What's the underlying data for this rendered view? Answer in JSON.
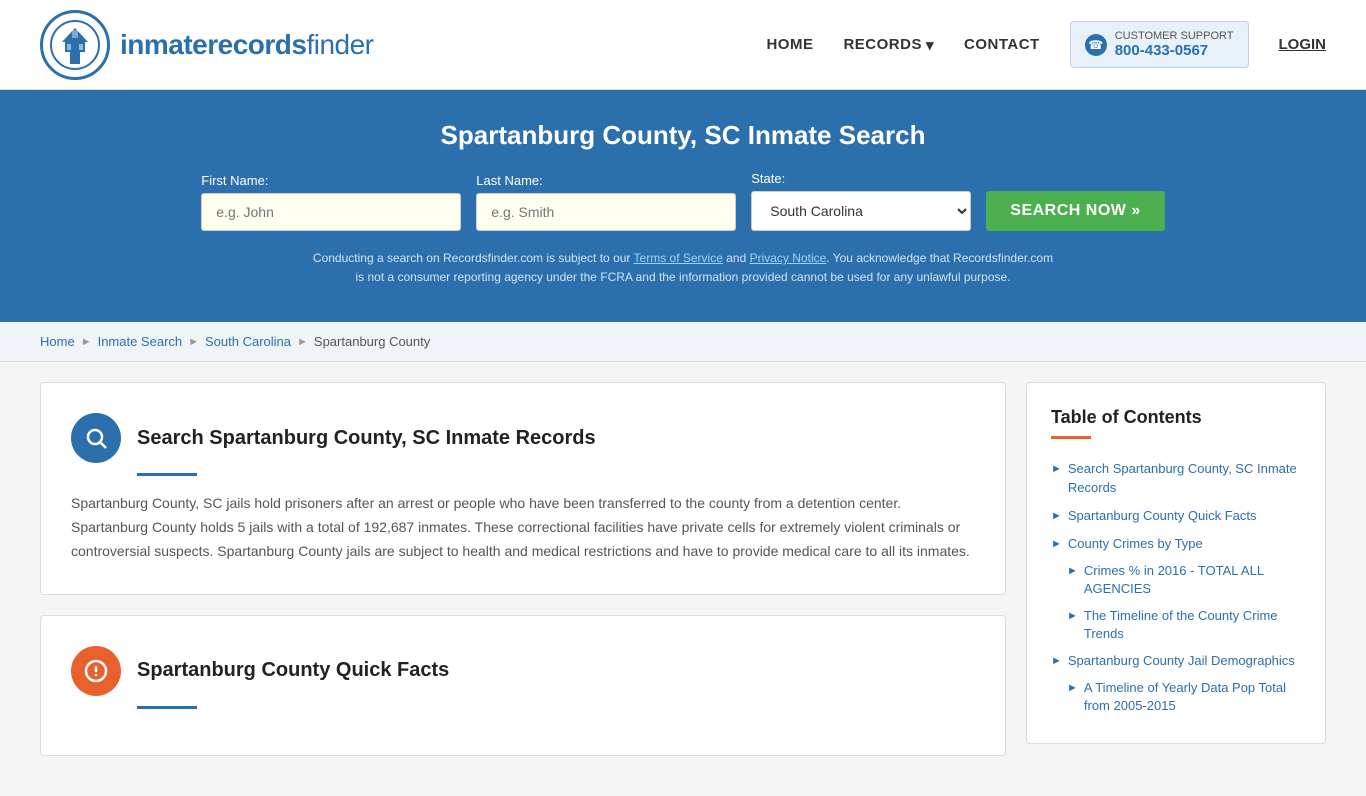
{
  "site": {
    "logo_text_light": "inmaterecords",
    "logo_text_bold": "finder",
    "title": "Spartanburg County, SC Inmate Search"
  },
  "nav": {
    "home_label": "HOME",
    "records_label": "RECORDS",
    "contact_label": "CONTACT",
    "support_label": "CUSTOMER SUPPORT",
    "support_number": "800-433-0567",
    "login_label": "LOGIN"
  },
  "search": {
    "first_name_label": "First Name:",
    "first_name_placeholder": "e.g. John",
    "last_name_label": "Last Name:",
    "last_name_placeholder": "e.g. Smith",
    "state_label": "State:",
    "state_value": "South Carolina",
    "button_label": "SEARCH NOW »",
    "disclaimer": "Conducting a search on Recordsfinder.com is subject to our Terms of Service and Privacy Notice. You acknowledge that Recordsfinder.com is not a consumer reporting agency under the FCRA and the information provided cannot be used for any unlawful purpose."
  },
  "breadcrumb": {
    "items": [
      {
        "label": "Home",
        "href": "#"
      },
      {
        "label": "Inmate Search",
        "href": "#"
      },
      {
        "label": "South Carolina",
        "href": "#"
      },
      {
        "label": "Spartanburg County",
        "current": true
      }
    ]
  },
  "main_section": {
    "title": "Search Spartanburg County, SC Inmate Records",
    "body": "Spartanburg County, SC jails hold prisoners after an arrest or people who have been transferred to the county from a detention center. Spartanburg County holds 5 jails with a total of 192,687 inmates. These correctional facilities have private cells for extremely violent criminals or controversial suspects. Spartanburg County jails are subject to health and medical restrictions and have to provide medical care to all its inmates."
  },
  "quick_facts_section": {
    "title": "Spartanburg County Quick Facts"
  },
  "toc": {
    "title": "Table of Contents",
    "items": [
      {
        "label": "Search Spartanburg County, SC Inmate Records",
        "sub": false
      },
      {
        "label": "Spartanburg County Quick Facts",
        "sub": false
      },
      {
        "label": "County Crimes by Type",
        "sub": false
      },
      {
        "label": "Crimes % in 2016 - TOTAL ALL AGENCIES",
        "sub": true
      },
      {
        "label": "The Timeline of the County Crime Trends",
        "sub": true
      },
      {
        "label": "Spartanburg County Jail Demographics",
        "sub": false
      },
      {
        "label": "A Timeline of Yearly Data Pop Total from 2005-2015",
        "sub": true
      }
    ]
  },
  "colors": {
    "accent_blue": "#2c6fad",
    "accent_green": "#4caf50",
    "hero_bg": "#2c6fad",
    "toc_underline": "#e8612c"
  }
}
